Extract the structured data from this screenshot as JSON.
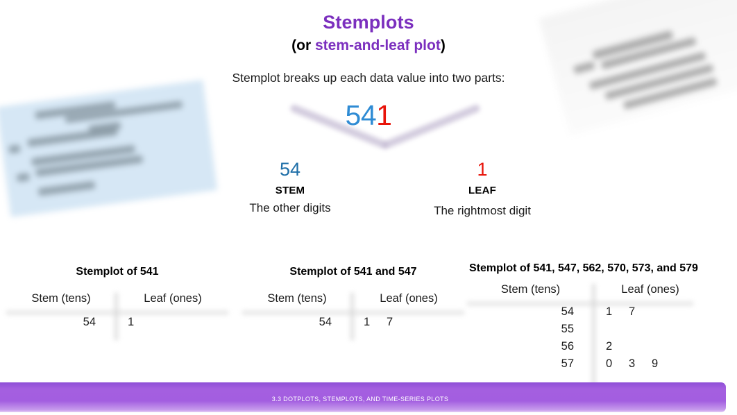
{
  "slide": {
    "title": "Stemplots",
    "subtitle_prefix": "(or ",
    "subtitle_highlight": "stem-and-leaf plot",
    "subtitle_suffix": ")",
    "lead_text": "Stemplot breaks up each data value into two parts:",
    "colors": {
      "purple": "#7b2fbe",
      "blue": "#2e8bd4",
      "blue_dark": "#1f6fa8",
      "red": "#e8140a",
      "footer_purple": "#a35ee0"
    }
  },
  "example_number": {
    "stem_digits": "54",
    "leaf_digit": "1"
  },
  "branches": {
    "stem": {
      "value": "54",
      "kind": "STEM",
      "description": "The other digits"
    },
    "leaf": {
      "value": "1",
      "kind": "LEAF",
      "description": "The rightmost digit"
    }
  },
  "plots": [
    {
      "title": "Stemplot of 541",
      "header_stem": "Stem (tens)",
      "header_leaf": "Leaf (ones)",
      "rows": [
        {
          "stem": "54",
          "leaves": [
            "1"
          ]
        }
      ]
    },
    {
      "title": "Stemplot of 541 and 547",
      "header_stem": "Stem (tens)",
      "header_leaf": "Leaf (ones)",
      "rows": [
        {
          "stem": "54",
          "leaves": [
            "1",
            "7"
          ]
        }
      ]
    },
    {
      "title": "Stemplot of 541, 547, 562, 570, 573, and 579",
      "header_stem": "Stem (tens)",
      "header_leaf": "Leaf (ones)",
      "rows": [
        {
          "stem": "54",
          "leaves": [
            "1",
            "7"
          ]
        },
        {
          "stem": "55",
          "leaves": []
        },
        {
          "stem": "56",
          "leaves": [
            "2"
          ]
        },
        {
          "stem": "57",
          "leaves": [
            "0",
            "3",
            "9"
          ]
        }
      ]
    }
  ],
  "footer": {
    "text": "3.3 DOTPLOTS, STEMPLOTS, AND TIME-SERIES PLOTS"
  }
}
